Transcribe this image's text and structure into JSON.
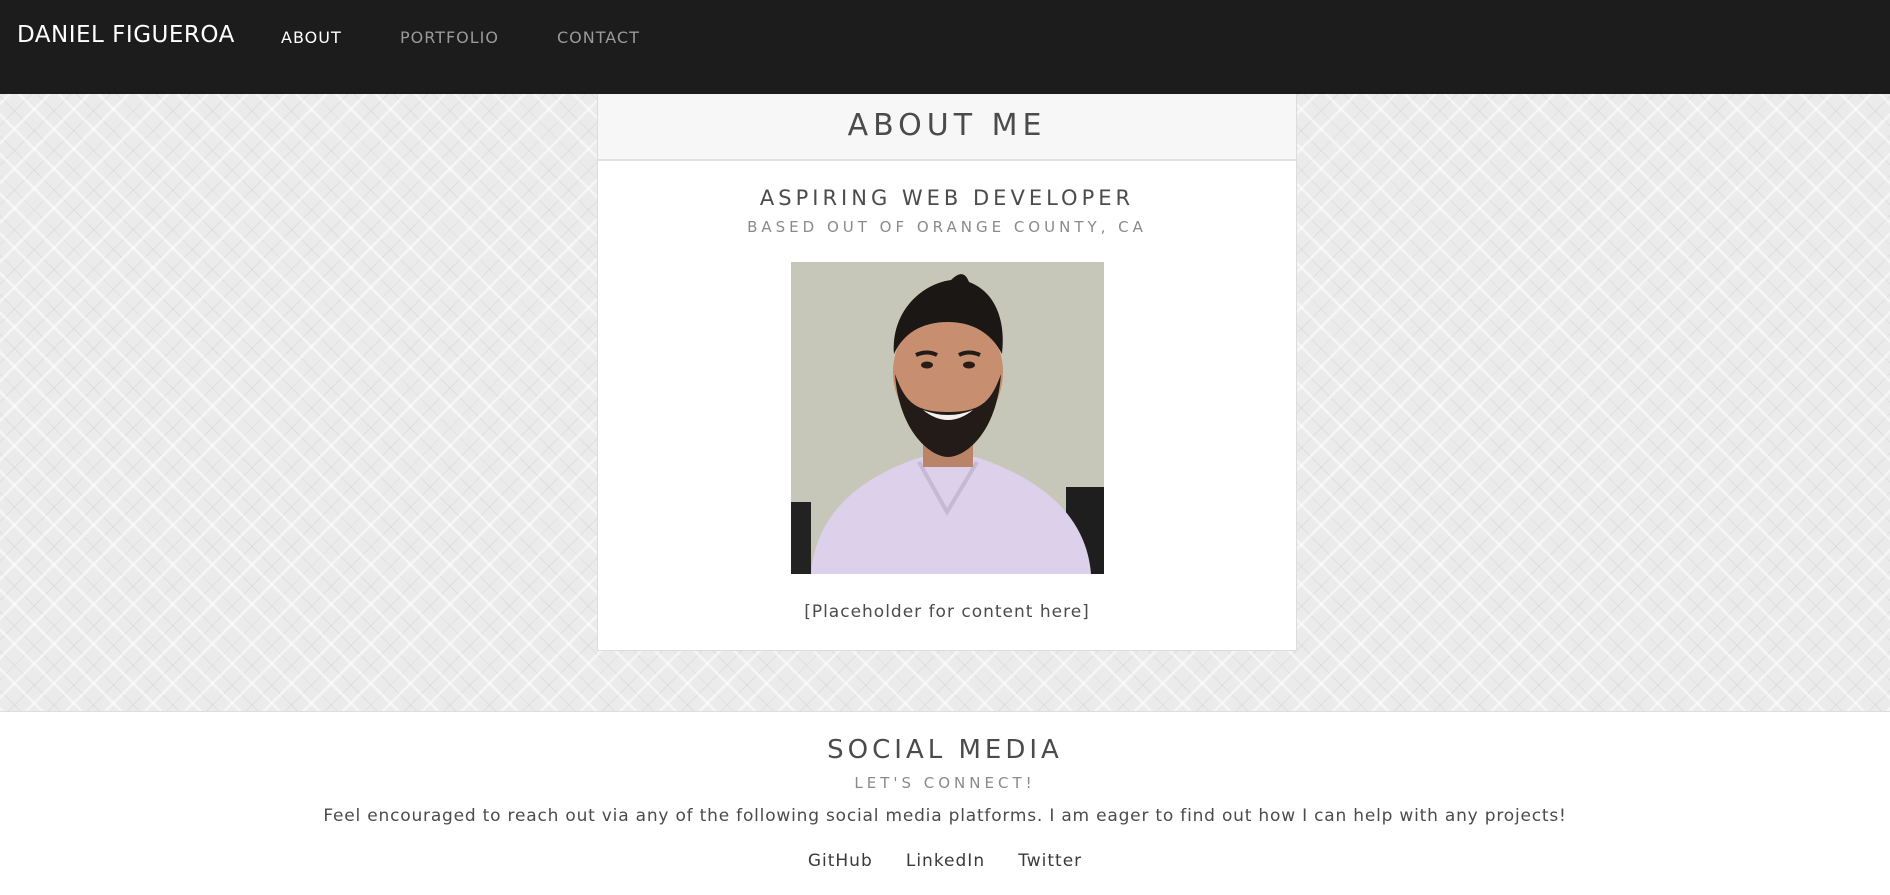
{
  "navbar": {
    "brand": "DANIEL FIGUEROA",
    "links": [
      {
        "label": "ABOUT",
        "active": true
      },
      {
        "label": "PORTFOLIO",
        "active": false
      },
      {
        "label": "CONTACT",
        "active": false
      }
    ]
  },
  "about": {
    "header": "ABOUT ME",
    "heading": "ASPIRING WEB DEVELOPER",
    "subheading": "BASED OUT OF ORANGE COUNTY, CA",
    "photo_icon": "profile-photo",
    "content": "[Placeholder for content here]"
  },
  "social": {
    "title": "SOCIAL MEDIA",
    "subtitle": "LET'S CONNECT!",
    "description": "Feel encouraged to reach out via any of the following social media platforms. I am eager to find out how I can help with any projects!",
    "links": [
      "GitHub",
      "LinkedIn",
      "Twitter"
    ]
  },
  "colors": {
    "navbar_bg": "#1c1c1c",
    "hero_bg": "#ebebeb",
    "text": "#4b4b4b",
    "muted": "#8a8a8a"
  }
}
